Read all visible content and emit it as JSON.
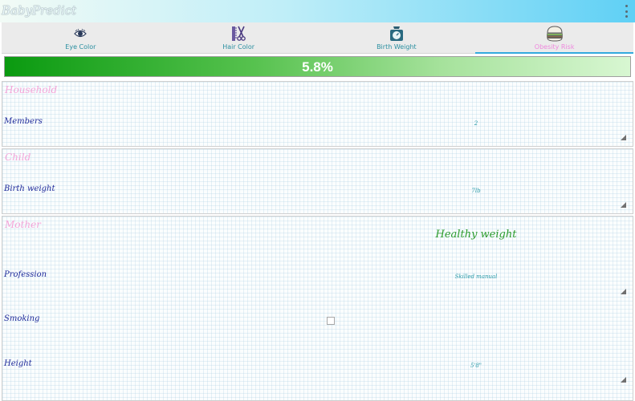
{
  "app": {
    "title": "BabyPredict"
  },
  "tabs": [
    {
      "label": "Eye Color",
      "icon": "eye-icon",
      "active": false
    },
    {
      "label": "Hair Color",
      "icon": "scissors-comb-icon",
      "active": false
    },
    {
      "label": "Birth Weight",
      "icon": "baby-scale-icon",
      "active": false
    },
    {
      "label": "Obesity Risk",
      "icon": "burger-icon",
      "active": true
    }
  ],
  "result": {
    "value": "5.8%",
    "level": 0.058
  },
  "household": {
    "title": "Household",
    "members_label": "Members",
    "members_value": "2"
  },
  "child": {
    "title": "Child",
    "birth_weight_label": "Birth weight",
    "birth_weight_value": "7lb"
  },
  "mother": {
    "title": "Mother",
    "status": "Healthy weight",
    "profession_label": "Profession",
    "profession_value": "Skilled manual",
    "smoking_label": "Smoking",
    "smoking_checked": false,
    "height_label": "Height",
    "height_value": "5'8\""
  },
  "colors": {
    "accent": "#33aadd",
    "section_title": "#f4a6d9",
    "label": "#1f2a9a",
    "value": "#2a9aa8",
    "status": "#2a9a2a",
    "progress_start": "#0a9a10",
    "progress_end": "#d8f7d2"
  }
}
